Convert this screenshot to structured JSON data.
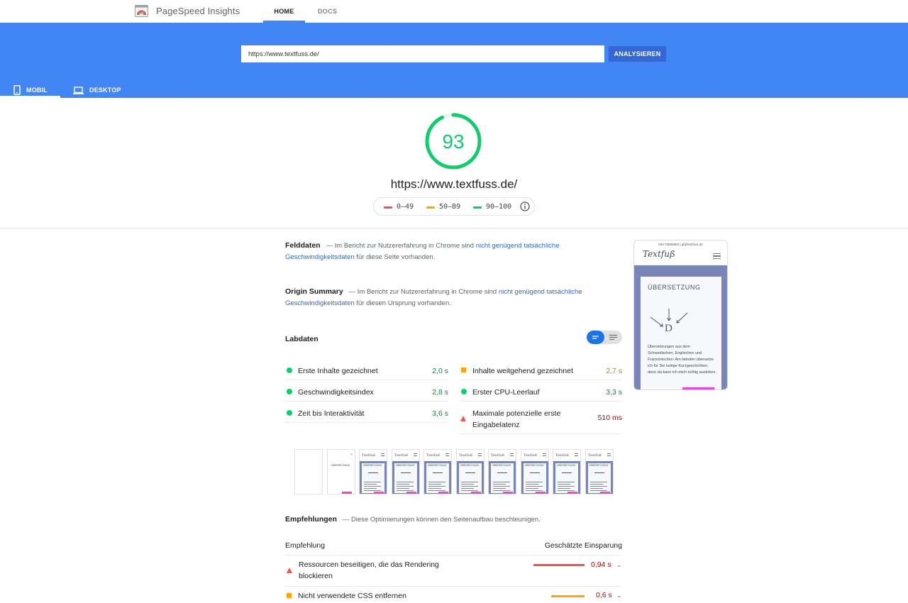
{
  "nav": {
    "brand": "PageSpeed Insights",
    "tabs": [
      {
        "label": "HOME",
        "active": true
      },
      {
        "label": "DOCS",
        "active": false
      }
    ]
  },
  "search": {
    "url_value": "https://www.textfuss.de/",
    "analyze_label": "ANALYSIEREN"
  },
  "device_tabs": [
    {
      "label": "MOBIL",
      "active": true
    },
    {
      "label": "DESKTOP",
      "active": false
    }
  ],
  "score": {
    "value": "93",
    "fraction": 0.93,
    "url": "https://www.textfuss.de/",
    "legend": [
      {
        "label": "0–49",
        "color": "#ff4e42"
      },
      {
        "label": "50–89",
        "color": "#ffa400"
      },
      {
        "label": "90–100",
        "color": "#0cce6b"
      }
    ]
  },
  "felddaten": {
    "title": "Felddaten",
    "pre": "— Im Bericht zur Nutzererfahrung in Chrome sind ",
    "link": "nicht genügend tatsächliche",
    "link2": "Geschwindigkeitsdaten",
    "post": " für diese Seite vorhanden."
  },
  "origin": {
    "title": "Origin Summary",
    "pre": "— Im Bericht zur Nutzererfahrung in Chrome sind ",
    "link": "nicht genügend tatsächliche",
    "link2": "Geschwindigkeitsdaten",
    "post": " für diesen Ursprung vorhanden."
  },
  "labdaten": {
    "title": "Labdaten",
    "metrics_left": [
      {
        "label": "Erste Inhalte gezeichnet",
        "value": "2,0 s",
        "status": "pass"
      },
      {
        "label": "Geschwindigkeitsindex",
        "value": "2,8 s",
        "status": "pass"
      },
      {
        "label": "Zeit bis Interaktivität",
        "value": "3,6 s",
        "status": "pass"
      }
    ],
    "metrics_right": [
      {
        "label": "Inhalte weitgehend gezeichnet",
        "value": "2,7 s",
        "status": "average"
      },
      {
        "label": "Erster CPU-Leerlauf",
        "value": "3,3 s",
        "status": "pass"
      },
      {
        "label": "Maximale potenzielle erste",
        "label2": "Eingabelatenz",
        "value": "510 ms",
        "status": "fail"
      }
    ]
  },
  "preview": {
    "topline": "040-73509964 | gf@textfuss.de",
    "logo": "Textfuß",
    "heading": "ÜBERSETZUNG",
    "text": "Übersetzungen aus dem Schwedischen, Englischen und Französischen: Am liebsten übersetze ich für Sie lustige Kurzgeschichten, denn da kann ich mich richtig austoben.",
    "thumb_heading": "ÜBERSETZUNG",
    "thumb_logo": "Textfuß"
  },
  "recommendations": {
    "title": "Empfehlungen",
    "subtitle": "— Diese Optimierungen können den Seitenaufbau beschleunigen.",
    "col_left": "Empfehlung",
    "col_right": "Geschätzte Einsparung",
    "items": [
      {
        "label": "Ressourcen beseitigen, die das Rendering",
        "label2": "blockieren",
        "value": "0,94 s",
        "status": "fail",
        "color": "#ff4e42"
      },
      {
        "label": "Nicht verwendete CSS entfernen",
        "value": "0,6 s",
        "status": "average",
        "color": "#ffa400"
      }
    ]
  }
}
